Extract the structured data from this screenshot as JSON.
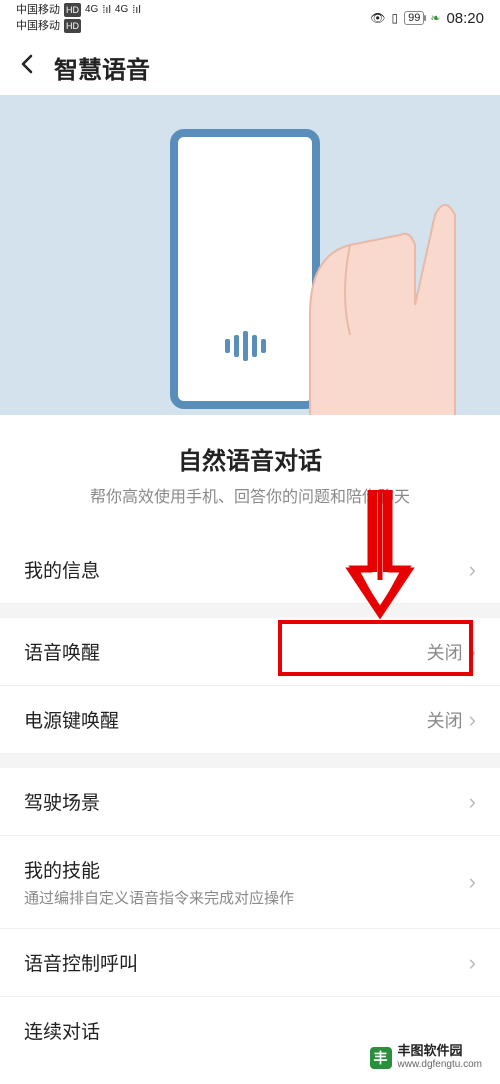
{
  "status": {
    "carrier1": "中国移动",
    "carrier1_badge": "HD",
    "carrier2": "中国移动",
    "carrier2_badge": "HD",
    "signal_4g": "4G",
    "battery_pct": "99",
    "time": "08:20"
  },
  "header": {
    "title": "智慧语音"
  },
  "section": {
    "title": "自然语音对话",
    "subtitle": "帮你高效使用手机、回答你的问题和陪你聊天"
  },
  "rows": {
    "my_info": {
      "label": "我的信息"
    },
    "voice_wake": {
      "label": "语音唤醒",
      "value": "关闭"
    },
    "power_wake": {
      "label": "电源键唤醒",
      "value": "关闭"
    },
    "driving": {
      "label": "驾驶场景"
    },
    "my_skills": {
      "label": "我的技能",
      "desc": "通过编排自定义语音指令来完成对应操作"
    },
    "voice_call": {
      "label": "语音控制呼叫"
    },
    "continuous": {
      "label": "连续对话"
    }
  },
  "watermark": {
    "name": "丰图软件园",
    "url": "www.dgfengtu.com"
  }
}
